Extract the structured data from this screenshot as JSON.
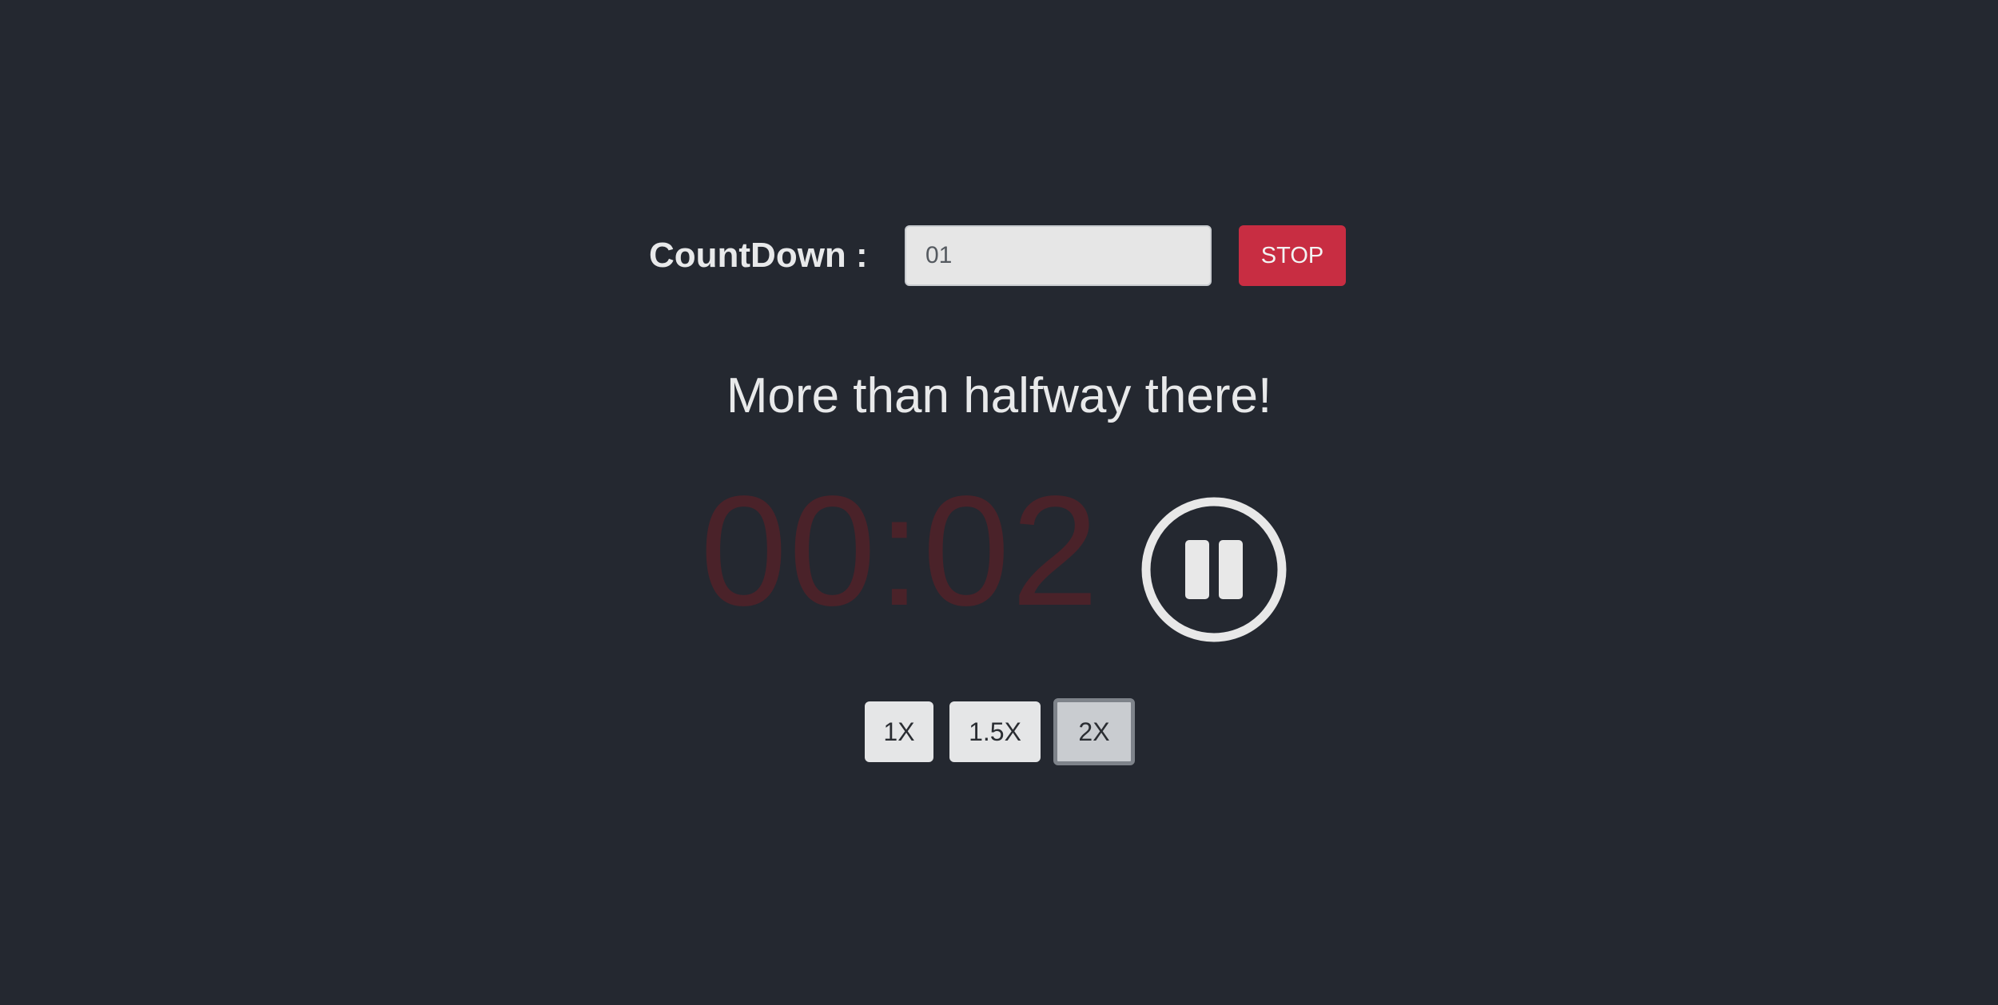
{
  "countdown": {
    "label": "CountDown :",
    "input_value": "01",
    "stop_label": "STOP"
  },
  "message": "More than halfway there!",
  "timer": {
    "display": "00:02",
    "color": "#4a2229"
  },
  "controls": {
    "pause_icon": "pause-circle-icon"
  },
  "speeds": [
    {
      "label": "1X",
      "selected": false
    },
    {
      "label": "1.5X",
      "selected": false
    },
    {
      "label": "2X",
      "selected": true
    }
  ],
  "colors": {
    "background": "#242830",
    "stop_button": "#c82d42",
    "text": "#e8e9ea"
  }
}
